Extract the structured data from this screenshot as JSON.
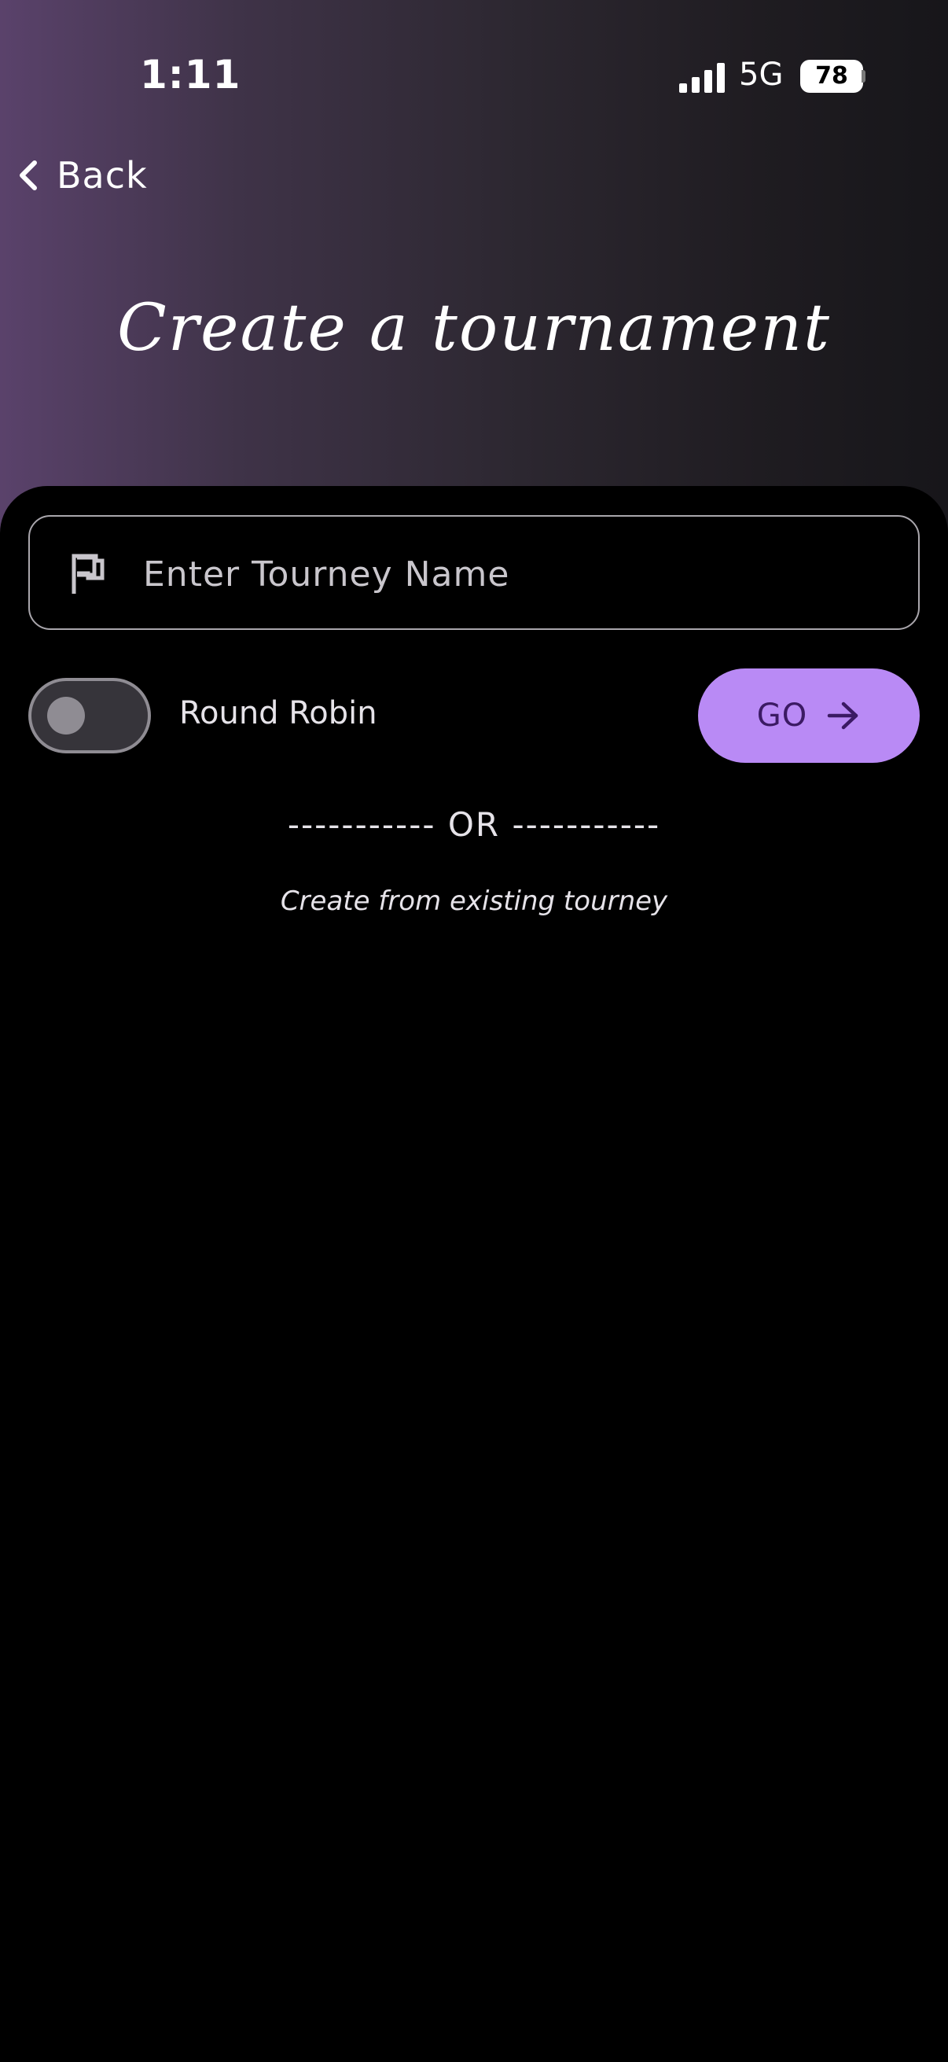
{
  "status_bar": {
    "time": "1:11",
    "network": "5G",
    "battery": "78",
    "signal_icon": "cellular-signal-icon"
  },
  "nav": {
    "back_label": "Back",
    "back_icon": "chevron-left-icon"
  },
  "page": {
    "title": "Create a tournament"
  },
  "form": {
    "name_placeholder": "Enter Tourney Name",
    "name_value": "",
    "name_icon": "flag-icon",
    "round_robin_label": "Round Robin",
    "round_robin_enabled": false,
    "go_label": "GO",
    "go_icon": "arrow-right-icon",
    "divider_text": "----------- OR -----------",
    "existing_link": "Create from existing tourney"
  },
  "colors": {
    "accent": "#b98af5",
    "accent_text": "#3b1a63",
    "background": "#000000",
    "gradient_start": "#5a426b",
    "gradient_end": "#17161a"
  }
}
